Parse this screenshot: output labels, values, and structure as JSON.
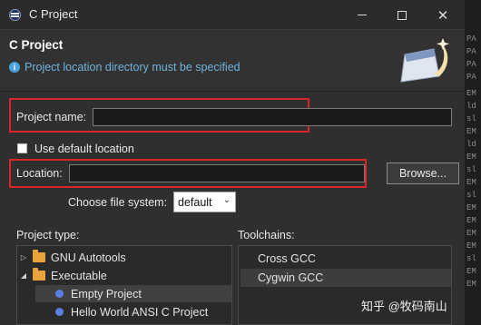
{
  "window": {
    "title": "C Project",
    "controls": {
      "minimize": "minimize-icon",
      "maximize": "maximize-icon",
      "close": "✕"
    }
  },
  "header": {
    "title": "C Project",
    "message": "Project location directory must be specified",
    "message_icon": "info-icon"
  },
  "form": {
    "project_name_label": "Project name:",
    "project_name_value": "",
    "use_default_label": "Use default location",
    "use_default_checked": false,
    "location_label": "Location:",
    "location_value": "",
    "browse_label": "Browse...",
    "file_system_label": "Choose file system:",
    "file_system_value": "default"
  },
  "project_type": {
    "label": "Project type:",
    "items": [
      {
        "label": "GNU Autotools",
        "expanded": false,
        "kind": "folder"
      },
      {
        "label": "Executable",
        "expanded": true,
        "kind": "folder"
      },
      {
        "label": "Empty Project",
        "kind": "leaf",
        "selected": true
      },
      {
        "label": "Hello World ANSI C Project",
        "kind": "leaf"
      }
    ]
  },
  "toolchains": {
    "label": "Toolchains:",
    "items": [
      {
        "label": "Cross GCC"
      },
      {
        "label": "Cygwin GCC",
        "highlighted": true
      }
    ]
  },
  "edge_text": [
    "PA",
    "PA",
    "PA",
    "PA",
    "EM",
    "ld",
    "sl",
    "EM",
    "ld",
    "EM",
    "sl",
    "EM",
    "sl",
    "EM",
    "EM",
    "EM",
    "EM",
    "sl",
    "EM",
    "EM"
  ],
  "watermark": "知乎 @牧码南山",
  "colors": {
    "highlight_red": "#d8262b",
    "info_blue": "#6fb3dd",
    "folder": "#e8a33d",
    "leaf_dot": "#5b7fe0"
  }
}
